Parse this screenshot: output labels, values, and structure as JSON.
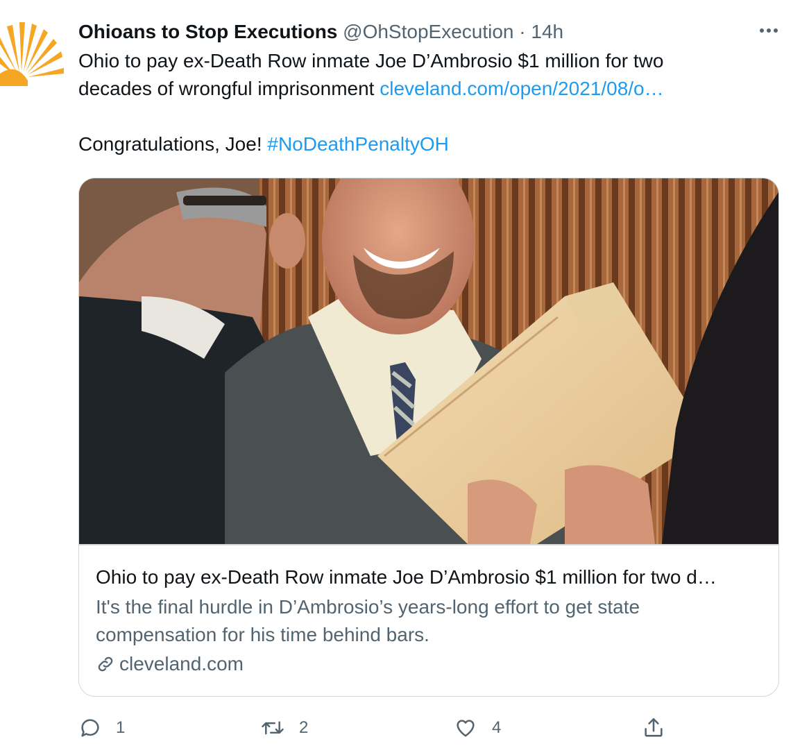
{
  "account": {
    "display_name": "Ohioans to Stop Executions",
    "handle": "@OhStopExecution",
    "separator": "·",
    "timestamp": "14h",
    "avatar_icon": "sunburst-logo-icon",
    "avatar_color": "#f5a623"
  },
  "tweet": {
    "line1": "Ohio to pay ex-Death Row inmate Joe D’Ambrosio $1 million for two",
    "line2_text": "decades of wrongful imprisonment",
    "line2_link": "cleveland.com/open/2021/08/o…",
    "line3_text": "Congratulations, Joe!",
    "hashtag": "#NoDeathPenaltyOH"
  },
  "card": {
    "title": "Ohio to pay ex-Death Row inmate Joe D’Ambrosio $1 million for two d…",
    "description": "It's the final hurdle in D’Ambrosio’s years-long effort to get state compensation for his time behind bars.",
    "domain": "cleveland.com",
    "domain_icon": "link-icon"
  },
  "actions": {
    "reply_count": "1",
    "retweet_count": "2",
    "like_count": "4",
    "reply_icon": "reply-icon",
    "retweet_icon": "retweet-icon",
    "like_icon": "heart-icon",
    "share_icon": "share-icon"
  },
  "colors": {
    "link": "#1d9bf0",
    "secondary_text": "#536471",
    "border": "#cfd9de"
  }
}
